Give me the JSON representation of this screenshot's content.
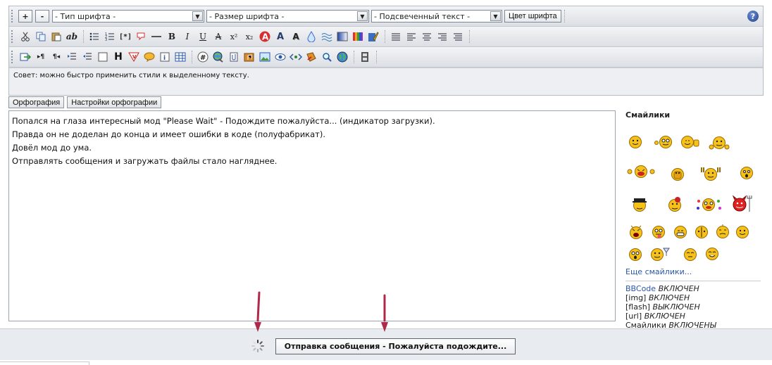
{
  "toolbar": {
    "size_inc": "+",
    "size_dec": "-",
    "font_type": "- Тип шрифта -",
    "font_size": "- Размер шрифта -",
    "highlight": "- Подсвеченный текст -",
    "font_color_btn": "Цвет шрифта",
    "help": "?"
  },
  "icons_row2": [
    "cut-icon",
    "copy-icon",
    "paste-icon",
    "paste-text-icon",
    "bullet-list-icon",
    "numbered-list-icon",
    "list-item-icon",
    "quote-icon",
    "horizontal-rule-icon",
    "bold-icon",
    "italic-icon",
    "underline-icon",
    "strikethrough-icon",
    "superscript-icon",
    "subscript-icon",
    "font-color-icon",
    "font-bg-icon",
    "text-shadow-icon",
    "blur-icon",
    "wave-icon",
    "gradient-icon",
    "rainbow-icon",
    "marker-icon",
    "justify-icon",
    "align-left-icon",
    "align-center-icon",
    "align-right-icon",
    "align-justify-icon"
  ],
  "icons_row3": [
    "insert-icon",
    "ltr-icon",
    "rtl-icon",
    "indent-icon",
    "outdent-icon",
    "box-icon",
    "header-icon",
    "spoiler-icon",
    "offtopic-icon",
    "info-icon",
    "table-icon",
    "hash-icon",
    "link-icon",
    "attachment-icon",
    "music-icon",
    "image-icon",
    "hide-icon",
    "code-icon",
    "translit-icon",
    "search-icon",
    "globe-icon",
    "film-icon"
  ],
  "tip": "Совет: можно быстро применить стили к выделенному тексту.",
  "spell": {
    "check": "Орфография",
    "settings": "Настройки орфографии"
  },
  "message": {
    "lines": [
      "Попался на глаза интересный мод \"Please Wait\" - Подождите пожалуйста... (индикатор загрузки).",
      "Правда он не доделан до конца и имеет ошибки в коде (полуфабрикат).",
      "Довёл мод до ума.",
      "Отправлять сообщения и загружать файлы стало нагляднее."
    ]
  },
  "smilies": {
    "title": "Смайлики",
    "more": "Еще смайлики...",
    "items": [
      "smile-icon",
      "wink-icon",
      "thumbsup-icon",
      "clap-icon",
      "laugh-icon",
      "scared-icon",
      "rock-icon",
      "surprised-icon",
      "cool-icon",
      "rose-icon",
      "crazy-icon",
      "devil-icon",
      "shout-icon",
      "tongue-icon",
      "grin-icon",
      "mask-icon",
      "dizzy-icon",
      "smile2-icon",
      "shocked-icon",
      "drink-icon",
      "shy-icon",
      "blush-icon"
    ]
  },
  "bbinfo": {
    "bbcode_label": "BBCode",
    "bbcode_state": "ВКЛЮЧЕН",
    "img_label": "[img]",
    "img_state": "ВКЛЮЧЕН",
    "flash_label": "[flash]",
    "flash_state": "ВЫКЛЮЧЕН",
    "url_label": "[url]",
    "url_state": "ВКЛЮЧЕН",
    "smilies_label": "Смайлики",
    "smilies_state": "ВКЛЮЧЕНЫ"
  },
  "submit": {
    "label": "Отправка сообщения - Пожалуйста подождите..."
  },
  "colors": {
    "accent_link": "#2a57a8",
    "annotation_arrow": "#b0284a",
    "smiley_yellow": "#f6c21a"
  }
}
